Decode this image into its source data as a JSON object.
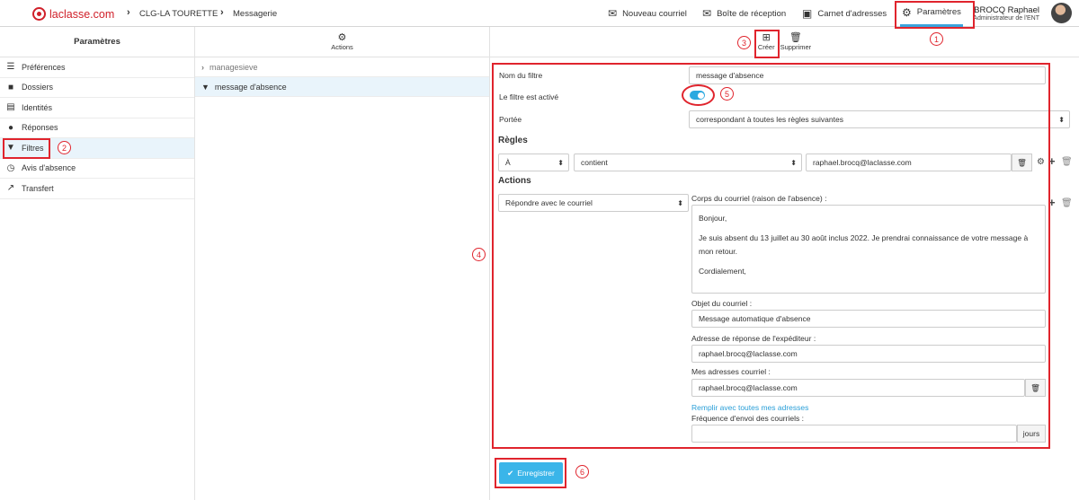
{
  "topbar": {
    "logo_text": "laclasse.com",
    "crumb_school": "CLG-LA TOURETTE",
    "crumb_app": "Messagerie",
    "nav": {
      "new_mail": "Nouveau courriel",
      "inbox": "Boîte de réception",
      "contacts": "Carnet d'adresses",
      "settings": "Paramètres"
    },
    "user_name": "BROCQ Raphael",
    "user_role": "Administrateur de l'ENT"
  },
  "sidebar": {
    "title": "Paramètres",
    "items": [
      {
        "label": "Préférences",
        "icon": "sliders-icon"
      },
      {
        "label": "Dossiers",
        "icon": "folder-icon"
      },
      {
        "label": "Identités",
        "icon": "id-card-icon"
      },
      {
        "label": "Réponses",
        "icon": "comment-icon"
      },
      {
        "label": "Filtres",
        "icon": "filter-icon"
      },
      {
        "label": "Avis d'absence",
        "icon": "clock-icon"
      },
      {
        "label": "Transfert",
        "icon": "share-icon"
      }
    ]
  },
  "filters_list": {
    "actions_label": "Actions",
    "set_name": "managesieve",
    "selected_filter": "message d'absence"
  },
  "toolbar": {
    "create": "Créer",
    "delete": "Supprimer"
  },
  "form": {
    "filter_name_label": "Nom du filtre",
    "filter_name_value": "message d'absence",
    "enabled_label": "Le filtre est activé",
    "enabled": true,
    "scope_label": "Portée",
    "scope_value": "correspondant à toutes les règles suivantes",
    "rules_heading": "Règles",
    "rule_field": "À",
    "rule_operator": "contient",
    "rule_value": "raphael.brocq@laclasse.com",
    "actions_heading": "Actions",
    "action_type": "Répondre avec le courriel",
    "body_label": "Corps du courriel (raison de l'absence) :",
    "body_lines": [
      "Bonjour,",
      "Je suis absent du 13 juillet au 30 août inclus 2022. Je prendrai connaissance de votre message à mon retour.",
      "Cordialement,"
    ],
    "subject_label": "Objet du courriel :",
    "subject_value": "Message automatique d'absence",
    "reply_to_label": "Adresse de réponse de l'expéditeur :",
    "reply_to_value": "raphael.brocq@laclasse.com",
    "my_addresses_label": "Mes adresses courriel :",
    "my_addresses_value": "raphael.brocq@laclasse.com",
    "fill_all_link": "Remplir avec toutes mes adresses",
    "frequency_label": "Fréquence d'envoi des courriels :",
    "frequency_value": "",
    "frequency_unit": "jours",
    "save_label": "Enregistrer"
  },
  "annotations": [
    "1",
    "2",
    "3",
    "4",
    "5",
    "6"
  ],
  "colors": {
    "brand_red": "#d0202a",
    "accent_blue": "#3ab5e9",
    "annotation_red": "#e0242d",
    "selected_row": "#e9f4fb"
  }
}
